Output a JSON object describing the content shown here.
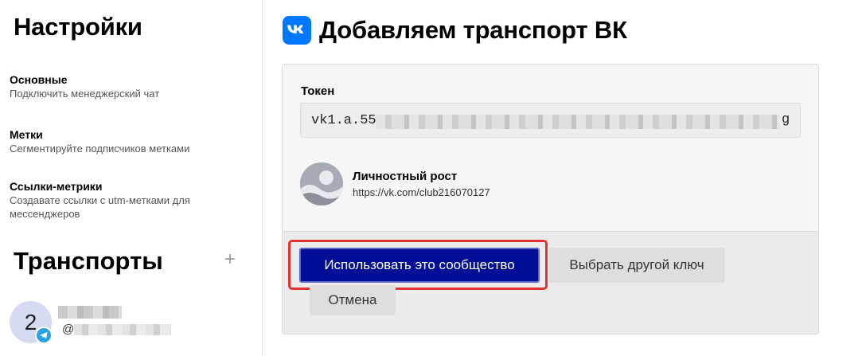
{
  "sidebar": {
    "title": "Настройки",
    "items": [
      {
        "label": "Основные",
        "description": "Подключить менеджерский чат"
      },
      {
        "label": "Метки",
        "description": "Сегментируйте подписчиков метками"
      },
      {
        "label": "Ссылки-метрики",
        "description": "Создавате ссылки с utm-метками для мессенджеров"
      }
    ],
    "transports_title": "Транспорты",
    "add_symbol": "+",
    "transport": {
      "avatar_letter": "2",
      "handle_prefix": "@",
      "icon": "telegram-icon"
    }
  },
  "main": {
    "title": "Добавляем транспорт ВК",
    "icon": "vk-logo-icon",
    "token_label": "Токен",
    "token_prefix": "vk1.a.55",
    "token_suffix": "g",
    "group": {
      "name": "Личностный рост",
      "link": "https://vk.com/club216070127"
    },
    "buttons": {
      "use_community": "Использовать это сообщество",
      "choose_other_key": "Выбрать другой ключ",
      "cancel": "Отмена"
    }
  },
  "colors": {
    "primary_button": "#000e96",
    "highlight": "#e03333",
    "vk_blue": "#0077ff",
    "telegram": "#2aa3e2"
  }
}
